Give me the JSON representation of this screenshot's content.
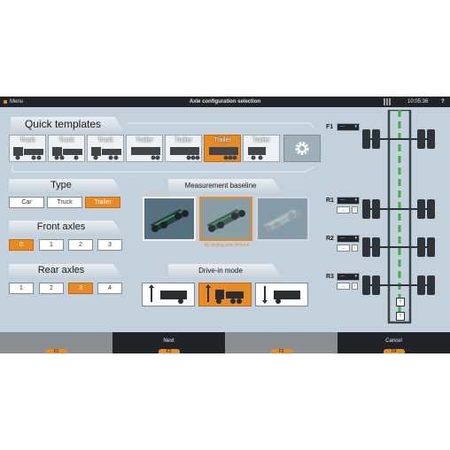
{
  "titlebar": {
    "menu": "Menu",
    "title": "Axle configuration selection",
    "time": "10:05:36",
    "help": "?"
  },
  "quick_templates": {
    "header": "Quick templates",
    "items": [
      {
        "label": "Truck",
        "kind": "truck",
        "selected": false
      },
      {
        "label": "Truck",
        "kind": "truck",
        "selected": false
      },
      {
        "label": "Truck",
        "kind": "truck",
        "selected": false
      },
      {
        "label": "Trailer",
        "kind": "trailer",
        "selected": false
      },
      {
        "label": "Trailer",
        "kind": "trailer",
        "selected": false
      },
      {
        "label": "Trailer",
        "kind": "trailer",
        "selected": true
      },
      {
        "label": "Trailer",
        "kind": "trailer",
        "selected": false
      }
    ],
    "settings_icon": "gear-icon"
  },
  "type": {
    "header": "Type",
    "options": [
      "Car",
      "Truck",
      "Trailer"
    ],
    "selected": "Trailer"
  },
  "front_axles": {
    "header": "Front axles",
    "options": [
      "0",
      "1",
      "2",
      "3"
    ],
    "selected": "0"
  },
  "rear_axles": {
    "header": "Rear axles",
    "options": [
      "1",
      "2",
      "3",
      "4"
    ],
    "selected": "3"
  },
  "measurement_baseline": {
    "header": "Measurement baseline",
    "caption": "By driving axle of truck",
    "selected_index": 1
  },
  "drive_in_mode": {
    "header": "Drive-in mode",
    "selected_index": 1
  },
  "axle_diagram": {
    "front_label": "F1",
    "rear_labels": [
      "R1",
      "R2",
      "R3"
    ],
    "dropdown_value": "---",
    "arrow_icon": "up-arrow-icon"
  },
  "function_bar": [
    {
      "label": "",
      "key": "F1"
    },
    {
      "label": "Next",
      "key": "F2"
    },
    {
      "label": "",
      "key": "F3"
    },
    {
      "label": "Cancel",
      "key": "F4"
    }
  ],
  "colors": {
    "accent": "#e98b24",
    "background": "#c3d1dc",
    "bar": "#202428",
    "path": "#3cb43c"
  }
}
